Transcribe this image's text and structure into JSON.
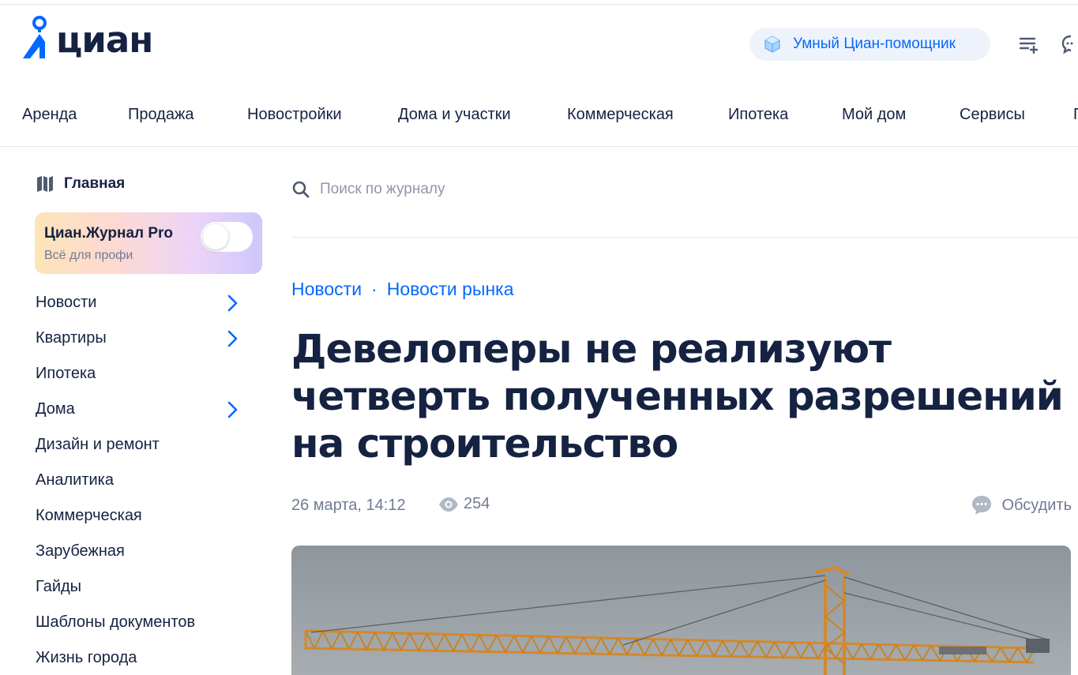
{
  "header": {
    "logo_text": "циан",
    "assistant_label": "Умный Циан-помощник"
  },
  "nav": {
    "items": [
      "Аренда",
      "Продажа",
      "Новостройки",
      "Дома и участки",
      "Коммерческая",
      "Ипотека",
      "Мой дом",
      "Сервисы"
    ]
  },
  "sidebar": {
    "home_label": "Главная",
    "pro": {
      "title": "Циан.Журнал Pro",
      "subtitle": "Всё для профи",
      "enabled": false
    },
    "items": [
      {
        "label": "Новости",
        "has_submenu": true
      },
      {
        "label": "Квартиры",
        "has_submenu": true
      },
      {
        "label": "Ипотека",
        "has_submenu": false
      },
      {
        "label": "Дома",
        "has_submenu": true
      },
      {
        "label": "Дизайн и ремонт",
        "has_submenu": false
      },
      {
        "label": "Аналитика",
        "has_submenu": false
      },
      {
        "label": "Коммерческая",
        "has_submenu": false
      },
      {
        "label": "Зарубежная",
        "has_submenu": false
      },
      {
        "label": "Гайды",
        "has_submenu": false
      },
      {
        "label": "Шаблоны документов",
        "has_submenu": false
      },
      {
        "label": "Жизнь города",
        "has_submenu": false
      }
    ]
  },
  "search": {
    "placeholder": "Поиск по журналу"
  },
  "article": {
    "breadcrumbs": [
      "Новости",
      "Новости рынка"
    ],
    "breadcrumb_separator": "·",
    "title": "Девелоперы не реализуют четверть полученных разрешений на строительство",
    "date": "26 марта, 14:12",
    "views": "254",
    "discuss_label": "Обсудить"
  },
  "colors": {
    "brand_blue": "#0468ff",
    "text_primary": "#152242",
    "text_secondary": "#707a95",
    "crane_orange": "#d4892a"
  }
}
